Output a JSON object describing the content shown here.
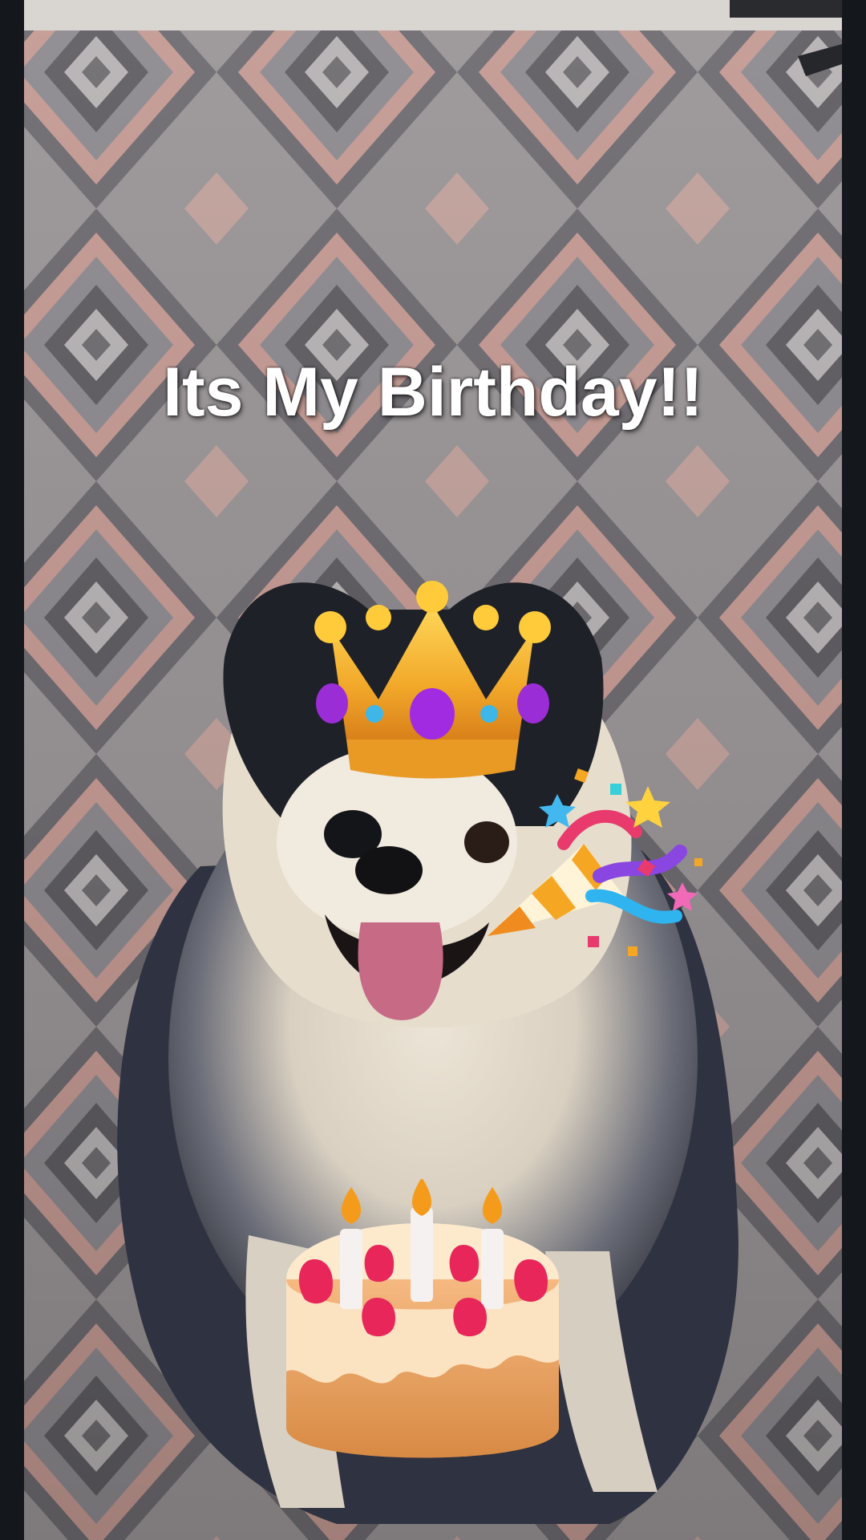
{
  "story": {
    "caption": "Its My Birthday!!"
  },
  "stickers": {
    "crown": "crown-emoji",
    "party_popper": "party-popper-emoji",
    "cake": "birthday-cake-emoji"
  },
  "colors": {
    "caption_text": "#ffffff",
    "crown_gold": "#f4b531",
    "gem_purple": "#a12be0",
    "cake_cream": "#fbe3c2",
    "strawberry": "#e8265a",
    "blanket_rose": "#c49a93",
    "blanket_grey": "#8c8a8c"
  }
}
